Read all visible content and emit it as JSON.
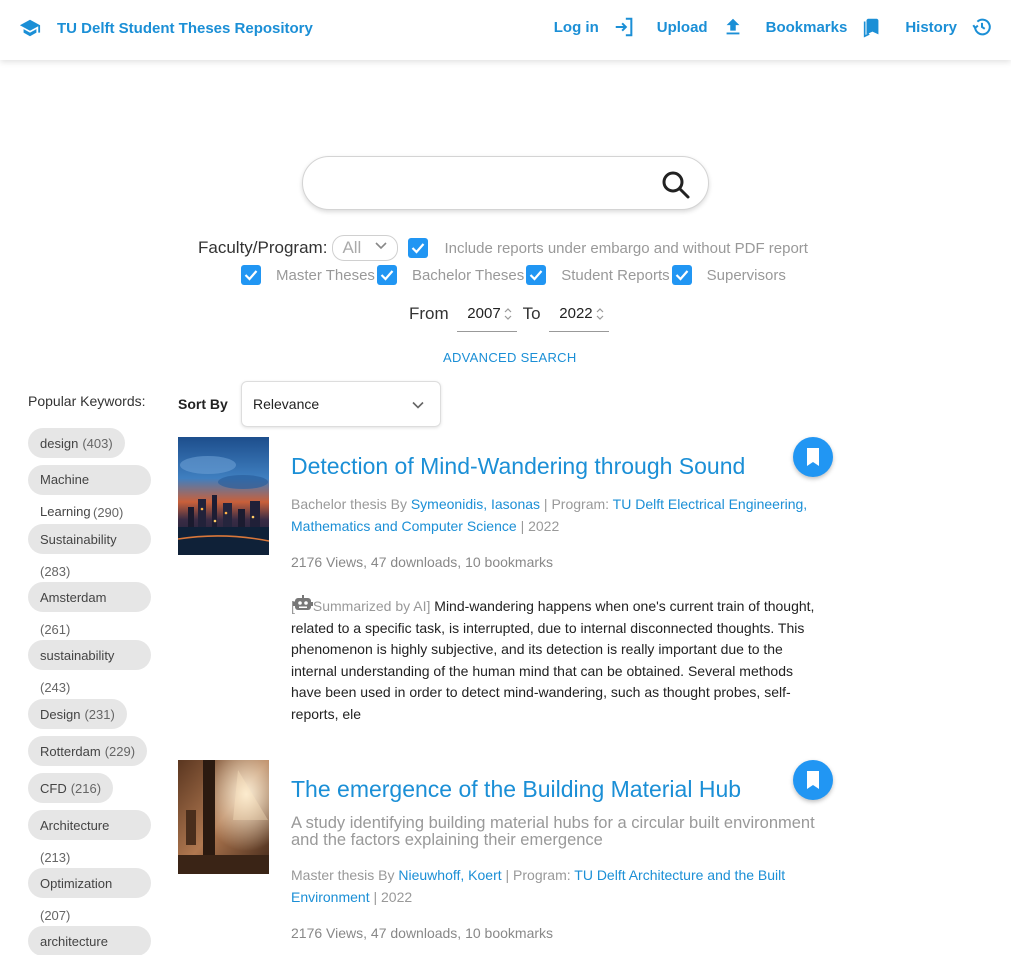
{
  "header": {
    "title": "TU Delft Student Theses Repository",
    "nav": [
      {
        "label": "Log in",
        "icon": "login-icon"
      },
      {
        "label": "Upload",
        "icon": "upload-icon"
      },
      {
        "label": "Bookmarks",
        "icon": "bookmarks-icon"
      },
      {
        "label": "History",
        "icon": "history-icon"
      }
    ]
  },
  "search": {
    "placeholder": "",
    "value": ""
  },
  "filters": {
    "faculty_label": "Faculty/Program:",
    "faculty_value": "All",
    "embargo_label": "Include reports under embargo and without PDF report",
    "types": [
      {
        "label": "Master Theses",
        "checked": true
      },
      {
        "label": "Bachelor Theses",
        "checked": true
      },
      {
        "label": "Student Reports",
        "checked": true
      },
      {
        "label": "Supervisors",
        "checked": true
      }
    ],
    "from_label": "From",
    "from_value": "2007",
    "to_label": "To",
    "to_value": "2022",
    "advanced": "ADVANCED SEARCH"
  },
  "sidebar": {
    "title": "Popular Keywords:",
    "keywords": [
      {
        "label": "design",
        "count": "(403)"
      },
      {
        "label": "Machine Learning",
        "count": "(290)"
      },
      {
        "label": "Sustainability",
        "count": "(283)"
      },
      {
        "label": "Amsterdam",
        "count": "(261)"
      },
      {
        "label": "sustainability",
        "count": "(243)"
      },
      {
        "label": "Design",
        "count": "(231)"
      },
      {
        "label": "Rotterdam",
        "count": "(229)"
      },
      {
        "label": "CFD",
        "count": "(216)"
      },
      {
        "label": "Architecture",
        "count": "(213)"
      },
      {
        "label": "Optimization",
        "count": "(207)"
      },
      {
        "label": "architecture",
        "count": ""
      }
    ]
  },
  "sort": {
    "label": "Sort By",
    "value": "Relevance"
  },
  "results": [
    {
      "title": "Detection of Mind-Wandering through Sound",
      "type": "Bachelor thesis By",
      "author": "Symeonidis, Iasonas",
      "program_label": "Program:",
      "program": "TU Delft Electrical Engineering, Mathematics and Computer Science",
      "year": "2022",
      "stats": "2176 Views, 47 downloads, 10 bookmarks",
      "ai_prefix": "[",
      "ai_label": "Summarized by AI]",
      "summary": "Mind-wandering happens when one's current train of thought, related to a specific task, is interrupted, due to internal disconnected thoughts. This phenomenon is highly subjective, and its detection is really important due to the internal understanding of the human mind that can be obtained. Several methods have been used in order to detect mind-wandering, such as thought probes, self-reports, ele"
    },
    {
      "title": "The emergence of the Building Material Hub",
      "subtitle": "A study identifying building material hubs for a circular built environment and the factors explaining their emergence",
      "type": "Master thesis By",
      "author": "Nieuwhoff, Koert",
      "program_label": "Program:",
      "program": "TU Delft Architecture and the Built Environment",
      "year": "2022",
      "stats": "2176 Views, 47 downloads, 10 bookmarks"
    }
  ],
  "colors": {
    "accent": "#1b8fd6",
    "checkbox": "#2196f3",
    "chip": "#e6e6e6"
  }
}
